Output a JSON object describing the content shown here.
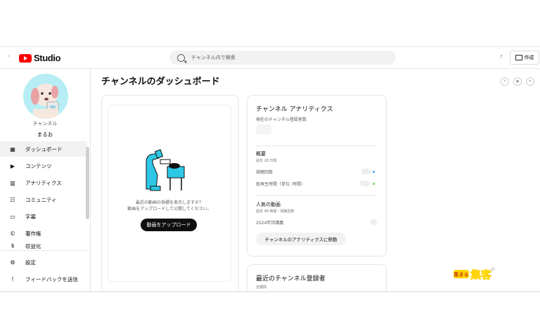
{
  "topbar": {
    "logo_text": "Studio",
    "search_placeholder": "チャンネル内で検索",
    "create_label": "作成",
    "help_symbol": "?"
  },
  "sidebar": {
    "channel_label": "チャンネル",
    "channel_name": "まるお",
    "items": [
      {
        "label": "ダッシュボード",
        "icon": "dashboard-icon"
      },
      {
        "label": "コンテンツ",
        "icon": "content-icon"
      },
      {
        "label": "アナリティクス",
        "icon": "analytics-icon"
      },
      {
        "label": "コミュニティ",
        "icon": "community-icon"
      },
      {
        "label": "字幕",
        "icon": "subtitles-icon"
      },
      {
        "label": "著作権",
        "icon": "copyright-icon"
      },
      {
        "label": "収益化",
        "icon": "monetization-icon"
      }
    ],
    "bottom_items": [
      {
        "label": "設定",
        "icon": "settings-icon"
      },
      {
        "label": "フィードバックを送信",
        "icon": "feedback-icon"
      }
    ]
  },
  "main": {
    "title": "チャンネルのダッシュボード",
    "upload_card": {
      "text_line1": "最近の動画の指標を表示しますか？",
      "text_line2": "動画をアップロードして公開してください。",
      "button": "動画をアップロード"
    },
    "analytics_card": {
      "title": "チャンネル アナリティクス",
      "subscriber_label": "現在のチャンネル登録者数",
      "summary_title": "概要",
      "summary_period": "過去 28 日間",
      "views_label": "視聴回数",
      "watch_time_label": "総再生時間（単位: 時間）",
      "popular_title": "人気の動画",
      "popular_period": "過去 48 時間・視聴回数",
      "popular_item": "2024年詩講義",
      "button": "チャンネルのアナリティクスに移動"
    },
    "subscribers_card": {
      "title": "最近のチャンネル登録者",
      "period": "全期間"
    },
    "header_icons": [
      "upload-status-icon",
      "live-icon",
      "post-icon"
    ]
  },
  "colors": {
    "youtube_red": "#ff0000",
    "dark_button": "#0f0f0f",
    "muted_text": "#606060",
    "avatar_bg": "#b7edf4",
    "illustration": "#2ec8e6",
    "dot_blue": "#3ea6ff",
    "dot_green": "#6fd35b"
  },
  "watermark": {
    "text": "集客"
  }
}
